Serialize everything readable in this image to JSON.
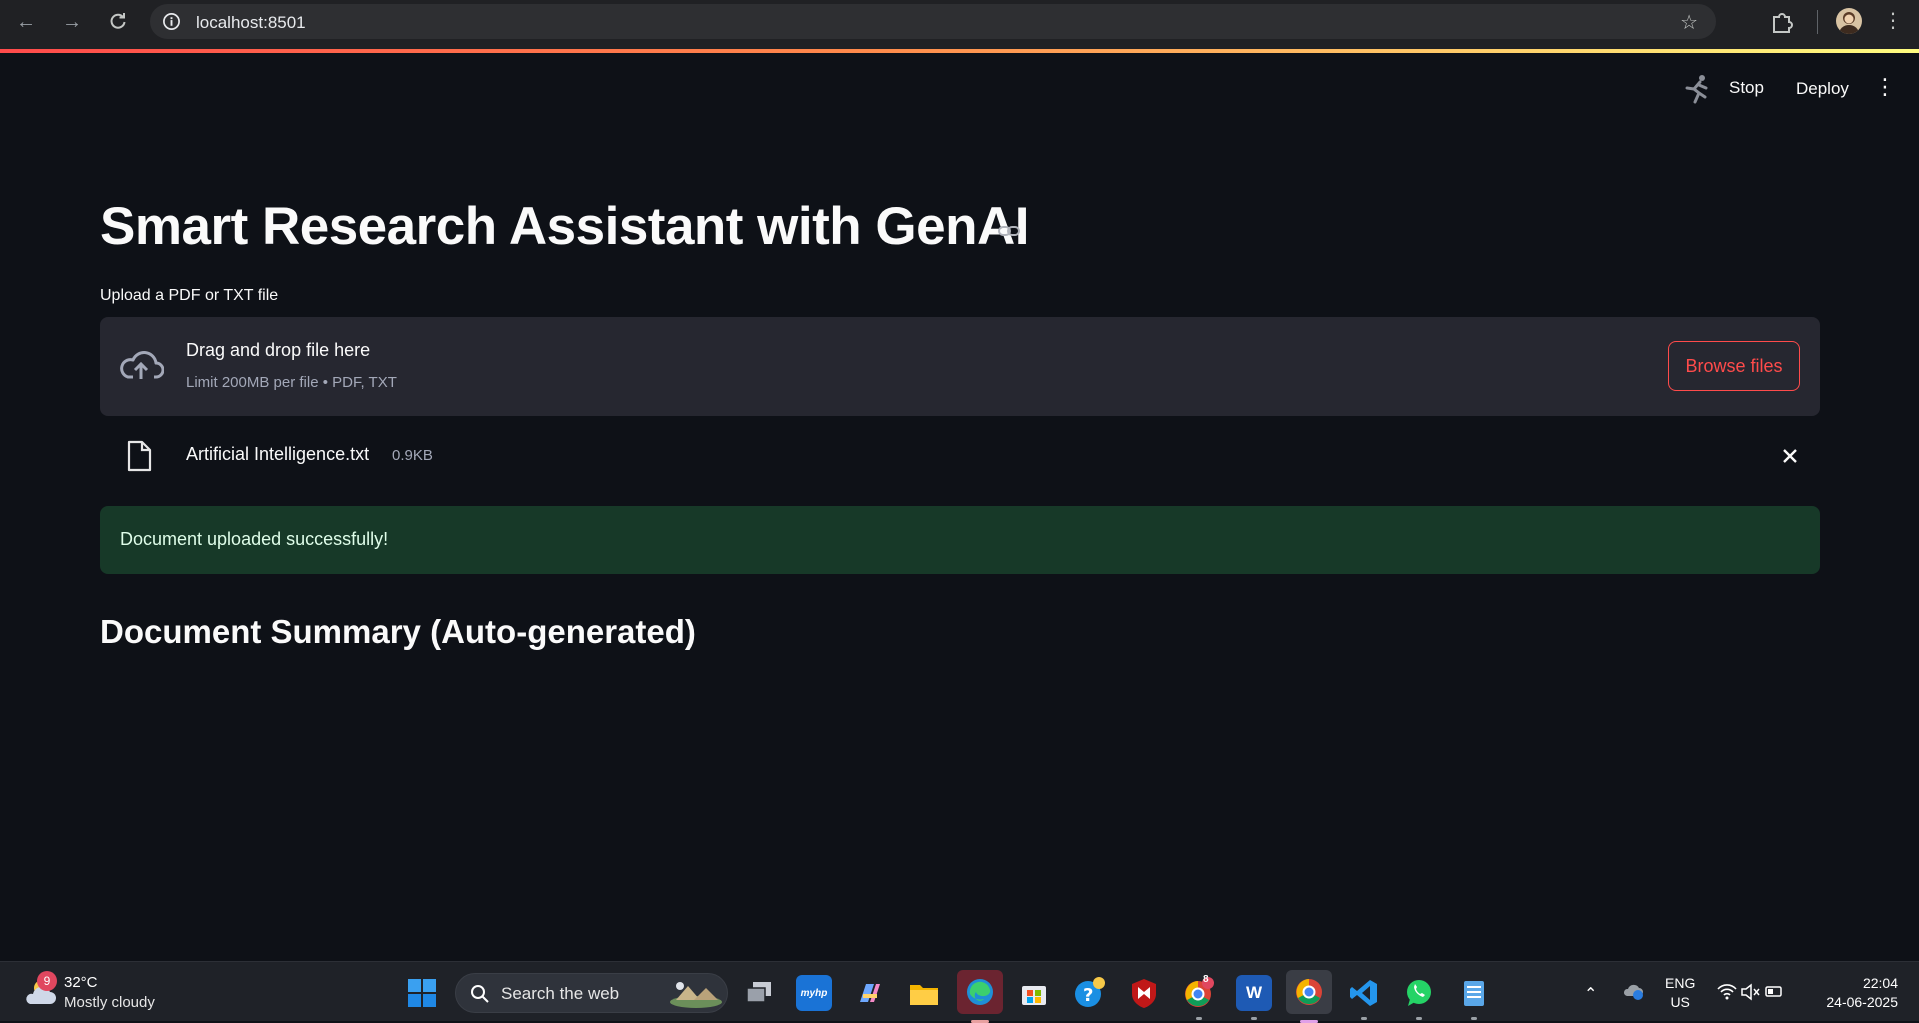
{
  "browser": {
    "url": "localhost:8501"
  },
  "header": {
    "stop_label": "Stop",
    "deploy_label": "Deploy"
  },
  "main": {
    "title": "Smart Research Assistant with GenAI",
    "uploader": {
      "label": "Upload a PDF or TXT file",
      "drop_title": "Drag and drop file here",
      "drop_subtitle": "Limit 200MB per file • PDF, TXT",
      "browse_label": "Browse files"
    },
    "file": {
      "name": "Artificial Intelligence.txt",
      "size": "0.9KB"
    },
    "success_message": "Document uploaded successfully!",
    "summary_heading": "Document Summary (Auto-generated)"
  },
  "taskbar": {
    "weather": {
      "temp": "32°C",
      "condition": "Mostly cloudy",
      "badge": "9"
    },
    "search_placeholder": "Search the web",
    "apps": [
      {
        "name": "task-view",
        "label": ""
      },
      {
        "name": "myhp",
        "label": "myhp"
      },
      {
        "name": "copilot",
        "label": ""
      },
      {
        "name": "file-explorer",
        "label": ""
      },
      {
        "name": "edge",
        "label": ""
      },
      {
        "name": "microsoft-store",
        "label": ""
      },
      {
        "name": "help",
        "label": ""
      },
      {
        "name": "mcafee",
        "label": ""
      },
      {
        "name": "chrome-profile",
        "label": "8"
      },
      {
        "name": "word",
        "label": "W"
      },
      {
        "name": "chrome",
        "label": ""
      },
      {
        "name": "vscode",
        "label": ""
      },
      {
        "name": "whatsapp",
        "label": ""
      },
      {
        "name": "notepad",
        "label": ""
      }
    ],
    "lang_line1": "ENG",
    "lang_line2": "US",
    "time": "22:04",
    "date": "24-06-2025"
  },
  "colors": {
    "background": "#0e1117",
    "accent": "#ff4b4b",
    "dropzone": "#262730",
    "success_bg": "#173928"
  }
}
